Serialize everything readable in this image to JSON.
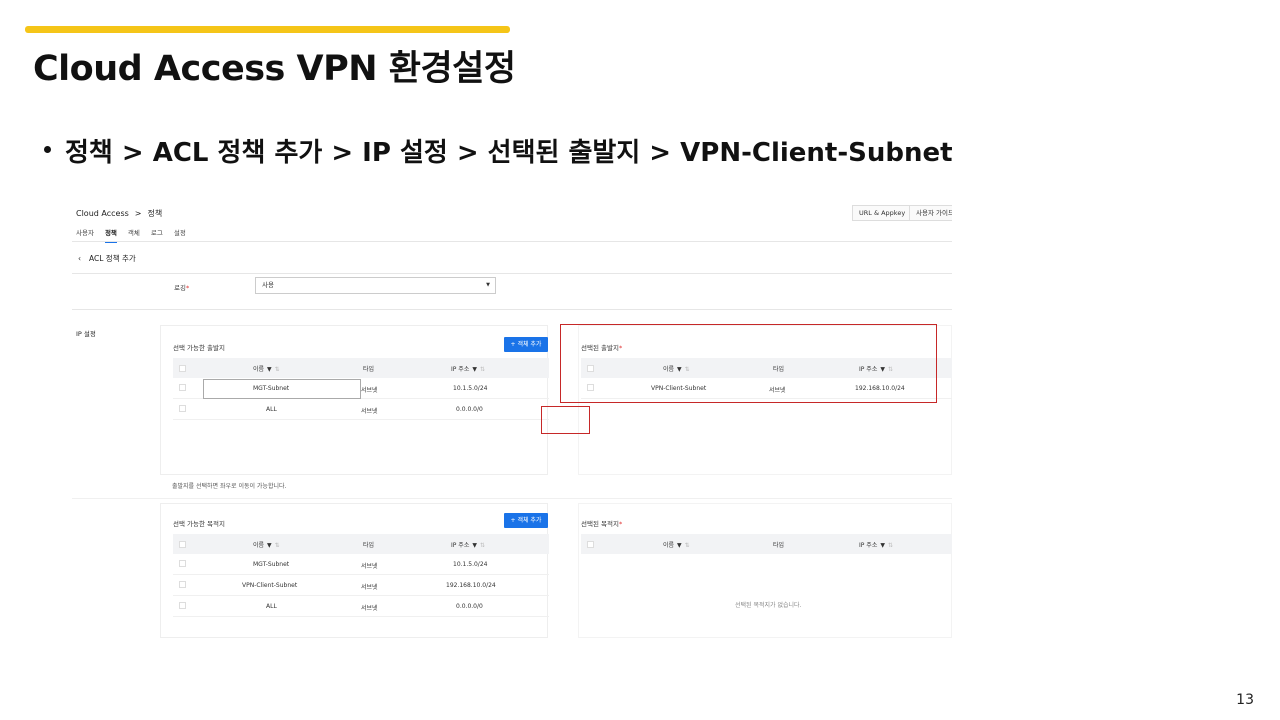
{
  "slide": {
    "title": "Cloud Access VPN 환경설정",
    "bullet": "정책 > ACL 정책 추가 > IP 설정 > 선택된 출발지 > VPN-Client-Subnet",
    "page_number": "13",
    "accent_color": "#f5c518"
  },
  "console": {
    "breadcrumb": {
      "root": "Cloud Access",
      "separator": ">",
      "current": "정책"
    },
    "top_buttons": [
      "URL & Appkey",
      "사용자 가이드"
    ],
    "tabs": [
      "사용자",
      "정책",
      "객체",
      "로그",
      "설정"
    ],
    "active_tab": "정책",
    "back_title": "ACL 정책 추가",
    "logging": {
      "label": "로깅",
      "value": "사용"
    },
    "ip_section_label": "IP 설정",
    "source_available": {
      "title": "선택 가능한 출발지",
      "add_button": "+ 객체 추가",
      "columns": [
        "이름",
        "타입",
        "IP 주소"
      ],
      "rows": [
        {
          "name": "MGT-Subnet",
          "type": "서브넷",
          "ip": "10.1.5.0/24"
        },
        {
          "name": "ALL",
          "type": "서브넷",
          "ip": "0.0.0.0/0"
        }
      ],
      "hint": "출발지를 선택하면 좌우로 이동이 가능합니다."
    },
    "source_selected": {
      "title": "선택된 출발지",
      "columns": [
        "이름",
        "타입",
        "IP 주소"
      ],
      "rows": [
        {
          "name": "VPN-Client-Subnet",
          "type": "서브넷",
          "ip": "192.168.10.0/24"
        }
      ]
    },
    "dest_available": {
      "title": "선택 가능한 목적지",
      "add_button": "+ 객체 추가",
      "columns": [
        "이름",
        "타입",
        "IP 주소"
      ],
      "rows": [
        {
          "name": "MGT-Subnet",
          "type": "서브넷",
          "ip": "10.1.5.0/24"
        },
        {
          "name": "VPN-Client-Subnet",
          "type": "서브넷",
          "ip": "192.168.10.0/24"
        },
        {
          "name": "ALL",
          "type": "서브넷",
          "ip": "0.0.0.0/0"
        }
      ]
    },
    "dest_selected": {
      "title": "선택된 목적지",
      "columns": [
        "이름",
        "타입",
        "IP 주소"
      ],
      "empty": "선택된 목적지가 없습니다."
    },
    "primary_color": "#1a73e8",
    "highlight_color": "#c62828"
  }
}
